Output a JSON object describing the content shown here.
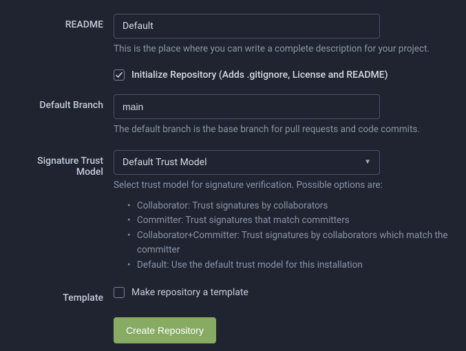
{
  "readme": {
    "label": "README",
    "value": "Default",
    "help": "This is the place where you can write a complete description for your project."
  },
  "initRepo": {
    "label": "Initialize Repository (Adds .gitignore, License and README)"
  },
  "defaultBranch": {
    "label": "Default Branch",
    "value": "main",
    "help": "The default branch is the base branch for pull requests and code commits."
  },
  "trustModel": {
    "label": "Signature Trust Model",
    "value": "Default Trust Model",
    "help": "Select trust model for signature verification. Possible options are:",
    "options": [
      "Collaborator: Trust signatures by collaborators",
      "Committer: Trust signatures that match committers",
      "Collaborator+Committer: Trust signatures by collaborators which match the committer",
      "Default: Use the default trust model for this installation"
    ]
  },
  "template": {
    "label": "Template",
    "checkboxLabel": "Make repository a template"
  },
  "submit": {
    "label": "Create Repository"
  }
}
